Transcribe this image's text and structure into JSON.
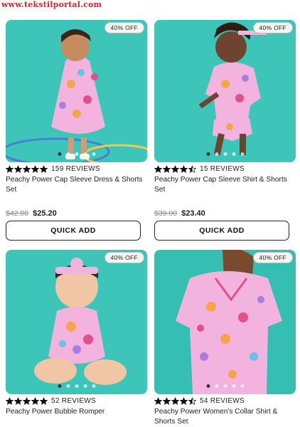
{
  "watermark": "www.tekstilportal.com",
  "colors": {
    "accent_background": "#3cc5b8",
    "badge_background": "#f6f5ef",
    "pattern_pink": "#f3b3df"
  },
  "products": [
    {
      "badge": "40% OFF",
      "rating": 5,
      "reviews": "159 REVIEWS",
      "name": "Peachy Power Cap Sleeve Dress & Shorts Set",
      "old_price": "$42.00",
      "new_price": "$25.20",
      "button": "QUICK ADD",
      "image": "girl-in-dress-photo"
    },
    {
      "badge": "40% OFF",
      "rating": 4.5,
      "reviews": "15 REVIEWS",
      "name": "Peachy Power Cap Sleeve Shirt & Shorts Set",
      "old_price": "$39.00",
      "new_price": "$23.40",
      "button": "QUICK ADD",
      "image": "girl-in-shirt-shorts-photo"
    },
    {
      "badge": "40% OFF",
      "rating": 5,
      "reviews": "52 REVIEWS",
      "name": "Peachy Power Bubble Romper",
      "image": "baby-in-romper-photo"
    },
    {
      "badge": "40% OFF",
      "rating": 4.5,
      "reviews": "54 REVIEWS",
      "name": "Peachy Power Women's Collar Shirt & Shorts Set",
      "image": "woman-in-pajama-photo"
    }
  ]
}
